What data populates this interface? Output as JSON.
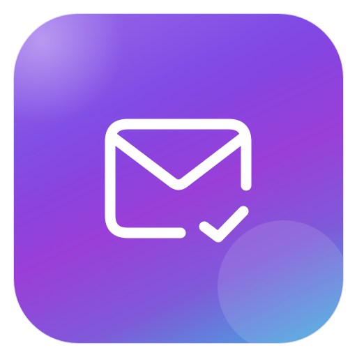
{
  "app_icon": {
    "icon": "mail-check-icon",
    "colors": {
      "gradient_start": "#8a55e6",
      "gradient_mid": "#9a3fd8",
      "gradient_end": "#3fb0de",
      "glyph": "#ffffff"
    }
  }
}
